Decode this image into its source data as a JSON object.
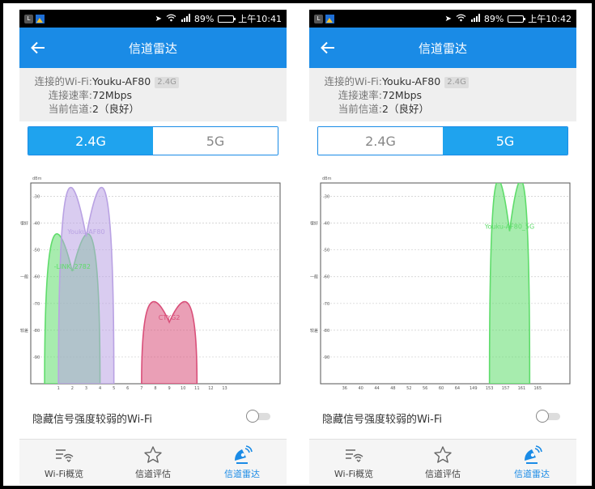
{
  "screens": [
    {
      "status": {
        "left_icon_a": "L",
        "battery": "89%",
        "battery_level": 0.89,
        "time": "上午10:41"
      },
      "title": "信道雷达",
      "info": [
        {
          "label": "连接的Wi-Fi:",
          "value": "Youku-AF80",
          "tag": "2.4G"
        },
        {
          "label": "连接速率:",
          "value": "72Mbps"
        },
        {
          "label": "当前信道:",
          "value": "2（良好）"
        }
      ],
      "tabs": [
        {
          "label": "2.4G",
          "active": true
        },
        {
          "label": "5G",
          "active": false
        }
      ],
      "toggle_label": "隐藏信号强度较弱的Wi-Fi",
      "toggle_on": false,
      "nav": [
        {
          "label": "Wi-Fi概览",
          "icon": "wifi-overview-icon",
          "active": false
        },
        {
          "label": "信道评估",
          "icon": "star-icon",
          "active": false
        },
        {
          "label": "信道雷达",
          "icon": "radar-icon",
          "active": true
        }
      ]
    },
    {
      "status": {
        "left_icon_a": "L",
        "battery": "89%",
        "battery_level": 0.89,
        "time": "上午10:42"
      },
      "title": "信道雷达",
      "info": [
        {
          "label": "连接的Wi-Fi:",
          "value": "Youku-AF80",
          "tag": "2.4G"
        },
        {
          "label": "连接速率:",
          "value": "72Mbps"
        },
        {
          "label": "当前信道:",
          "value": "2（良好）"
        }
      ],
      "tabs": [
        {
          "label": "2.4G",
          "active": false
        },
        {
          "label": "5G",
          "active": true
        }
      ],
      "toggle_label": "隐藏信号强度较弱的Wi-Fi",
      "toggle_on": false,
      "nav": [
        {
          "label": "Wi-Fi概览",
          "icon": "wifi-overview-icon",
          "active": false
        },
        {
          "label": "信道评估",
          "icon": "star-icon",
          "active": false
        },
        {
          "label": "信道雷达",
          "icon": "radar-icon",
          "active": true
        }
      ]
    }
  ],
  "colors": {
    "accent": "#1a8be6",
    "tab_active": "#1fa3ee",
    "green": "#5fdc6b",
    "purple": "#b9a2e3",
    "pink": "#d9507a"
  },
  "chart_data": [
    {
      "type": "area",
      "band": "2.4G",
      "ylabel": "dBm",
      "yticks": [
        -30,
        -40,
        -50,
        -60,
        -70,
        -80,
        -90
      ],
      "ylim": [
        -100,
        -25
      ],
      "quality_labels": [
        {
          "label": "很好",
          "y": -40
        },
        {
          "label": "一般",
          "y": -60
        },
        {
          "label": "较差",
          "y": -80
        }
      ],
      "xticks": [
        "1",
        "2",
        "3",
        "4",
        "5",
        "6",
        "7",
        "8",
        "9",
        "10",
        "11",
        "12",
        "13"
      ],
      "xlim": [
        -2,
        16
      ],
      "grid": true,
      "series": [
        {
          "name": "-LINK_2782",
          "x_left": -1,
          "x_right": 3,
          "peak_x": 1,
          "peak_y": -58,
          "color": "#5fdc6b"
        },
        {
          "name": "Youku-AF80",
          "x_left": 0,
          "x_right": 4,
          "peak_x": 2,
          "peak_y": -45,
          "color": "#b9a2e3"
        },
        {
          "name": "CTYG2",
          "x_left": 6,
          "x_right": 10,
          "peak_x": 8,
          "peak_y": -77,
          "color": "#d9507a"
        }
      ]
    },
    {
      "type": "area",
      "band": "5G",
      "ylabel": "dBm",
      "yticks": [
        -30,
        -40,
        -50,
        -60,
        -70,
        -80,
        -90
      ],
      "ylim": [
        -100,
        -25
      ],
      "quality_labels": [
        {
          "label": "很好",
          "y": -40
        },
        {
          "label": "一般",
          "y": -60
        },
        {
          "label": "较差",
          "y": -80
        }
      ],
      "xticks": [
        "36",
        "40",
        "44",
        "48",
        "52",
        "56",
        "60",
        "64",
        "149",
        "153",
        "157",
        "161",
        "165"
      ],
      "xlim": [
        -1.5,
        14
      ],
      "grid": true,
      "series": [
        {
          "name": "Youku-AF80_5G",
          "x_left": 9,
          "x_right": 11.5,
          "peak_x": 10.25,
          "peak_y": -43,
          "color": "#5fdc6b"
        }
      ]
    }
  ]
}
